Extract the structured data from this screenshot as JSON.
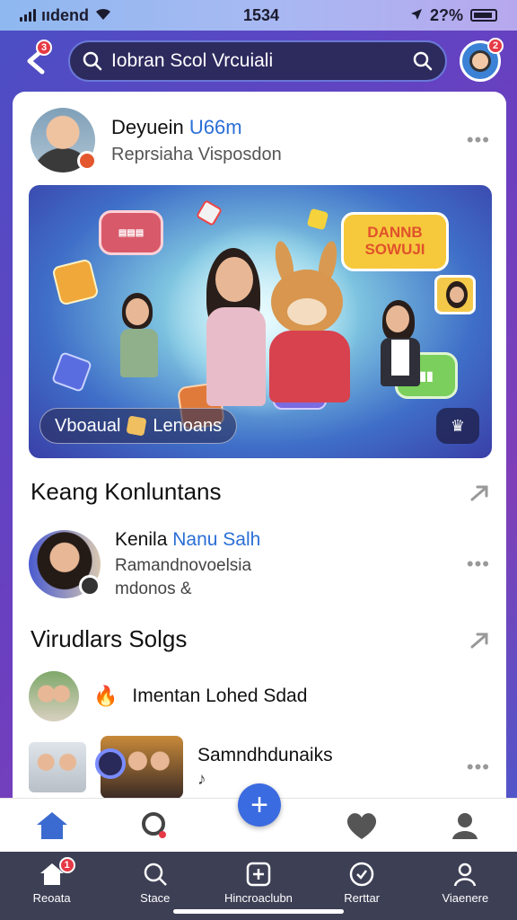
{
  "status_bar": {
    "carrier": "ııdend",
    "time": "1534",
    "battery": "2?%"
  },
  "topbar": {
    "back_badge": "3",
    "search_text": "Iobran Scol Vrcuiali",
    "avatar_badge": "2"
  },
  "post": {
    "name": "Deyuein",
    "name_highlight": "U66m",
    "subtitle": "Reprsiaha Visposdon",
    "hero_label": "Vboaual",
    "hero_label2": "Lenoans",
    "hero_bubble": "DANNB SOWUJI",
    "hero_btn": "♛"
  },
  "section1": {
    "title": "Keang Konluntans"
  },
  "row1": {
    "name": "Kenila",
    "name_highlight": "Nanu Salh",
    "sub1": "Ramandnovoelsia",
    "sub2": "mdonos &"
  },
  "section2": {
    "title": "Virudlars Solgs"
  },
  "row2": {
    "name": "Imentan Lohed Sdad"
  },
  "row3": {
    "name": "Samndhdunaiks",
    "sub": "♪"
  },
  "bottom_nav": [
    {
      "label": "Reoata",
      "badge": "1"
    },
    {
      "label": "Stace"
    },
    {
      "label": "Hincroaclubn"
    },
    {
      "label": "Rerttar"
    },
    {
      "label": "Viaenere"
    }
  ],
  "colors": {
    "accent": "#3b6be0",
    "badge": "#e63946",
    "link": "#2b6fd6"
  }
}
